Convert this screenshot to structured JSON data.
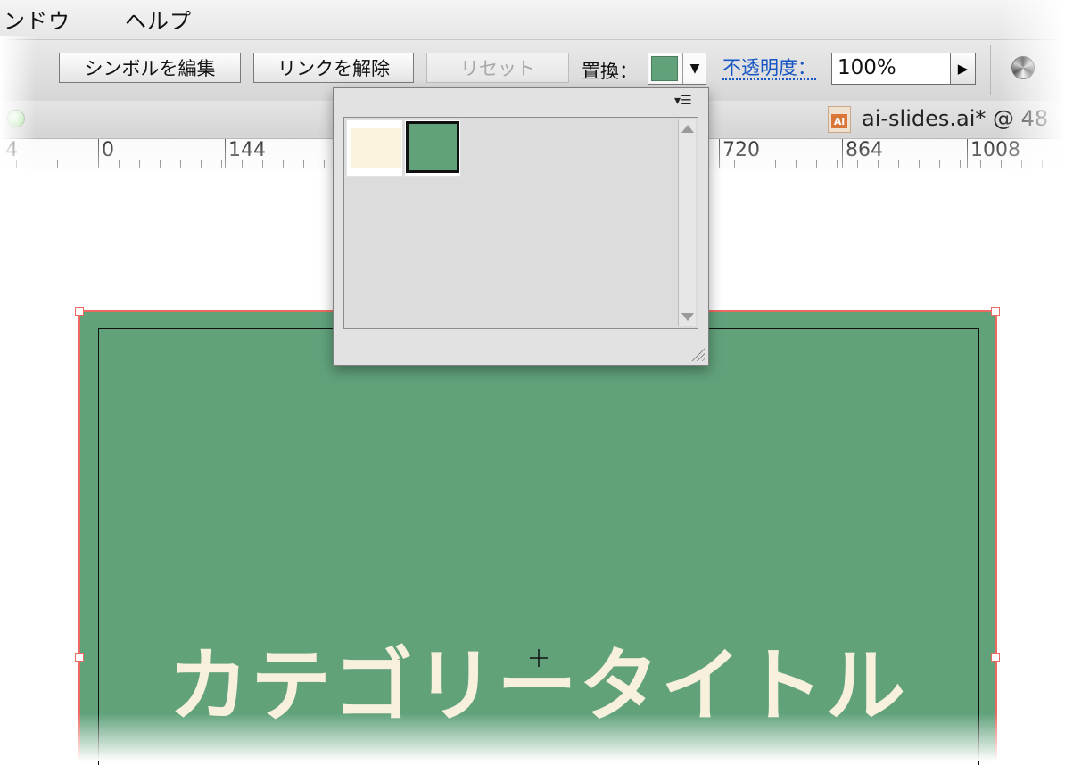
{
  "menubar": {
    "items": [
      "ンドウ",
      "ヘルプ"
    ]
  },
  "control_bar": {
    "edit_symbol": "シンボルを編集",
    "break_link": "リンクを解除",
    "reset": "リセット",
    "replace_label": "置換：",
    "selected_swatch_color": "#61a27b",
    "opacity_label": "不透明度：",
    "opacity_value": "100%"
  },
  "tab": {
    "file_icon": "Ai",
    "title": "ai-slides.ai* @ 48"
  },
  "ruler": {
    "labels": [
      "4",
      "0",
      "144",
      "720",
      "864",
      "1008"
    ]
  },
  "swatch_popup": {
    "menu_icon": "▾☰",
    "swatches": [
      {
        "name": "cream",
        "color": "#faf3de"
      },
      {
        "name": "green",
        "color": "#61a27b",
        "selected": true
      }
    ]
  },
  "artboard": {
    "background": "#61a27b",
    "title": "カテゴリータイトル",
    "title_color": "#f7f0dc"
  }
}
